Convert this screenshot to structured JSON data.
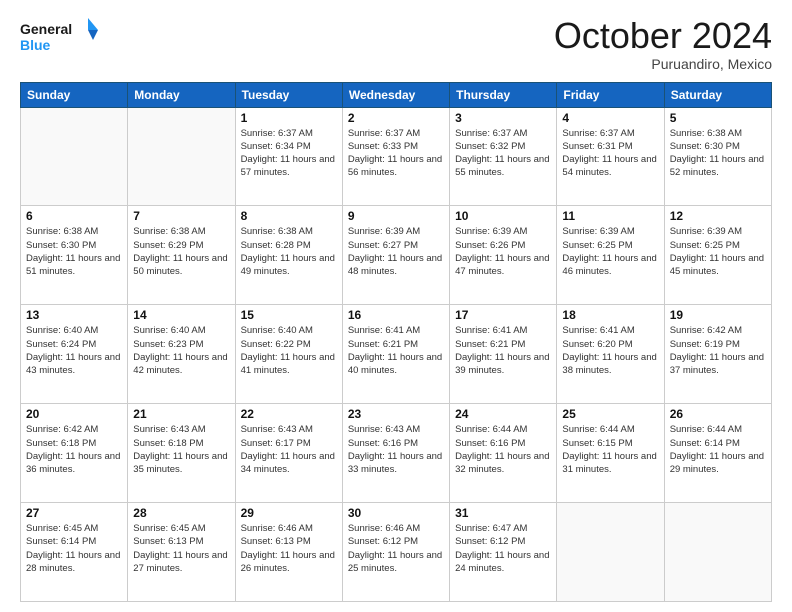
{
  "header": {
    "logo_line1": "General",
    "logo_line2": "Blue",
    "month_title": "October 2024",
    "subtitle": "Puruandiro, Mexico"
  },
  "weekdays": [
    "Sunday",
    "Monday",
    "Tuesday",
    "Wednesday",
    "Thursday",
    "Friday",
    "Saturday"
  ],
  "weeks": [
    [
      {
        "day": "",
        "info": ""
      },
      {
        "day": "",
        "info": ""
      },
      {
        "day": "1",
        "info": "Sunrise: 6:37 AM\nSunset: 6:34 PM\nDaylight: 11 hours and 57 minutes."
      },
      {
        "day": "2",
        "info": "Sunrise: 6:37 AM\nSunset: 6:33 PM\nDaylight: 11 hours and 56 minutes."
      },
      {
        "day": "3",
        "info": "Sunrise: 6:37 AM\nSunset: 6:32 PM\nDaylight: 11 hours and 55 minutes."
      },
      {
        "day": "4",
        "info": "Sunrise: 6:37 AM\nSunset: 6:31 PM\nDaylight: 11 hours and 54 minutes."
      },
      {
        "day": "5",
        "info": "Sunrise: 6:38 AM\nSunset: 6:30 PM\nDaylight: 11 hours and 52 minutes."
      }
    ],
    [
      {
        "day": "6",
        "info": "Sunrise: 6:38 AM\nSunset: 6:30 PM\nDaylight: 11 hours and 51 minutes."
      },
      {
        "day": "7",
        "info": "Sunrise: 6:38 AM\nSunset: 6:29 PM\nDaylight: 11 hours and 50 minutes."
      },
      {
        "day": "8",
        "info": "Sunrise: 6:38 AM\nSunset: 6:28 PM\nDaylight: 11 hours and 49 minutes."
      },
      {
        "day": "9",
        "info": "Sunrise: 6:39 AM\nSunset: 6:27 PM\nDaylight: 11 hours and 48 minutes."
      },
      {
        "day": "10",
        "info": "Sunrise: 6:39 AM\nSunset: 6:26 PM\nDaylight: 11 hours and 47 minutes."
      },
      {
        "day": "11",
        "info": "Sunrise: 6:39 AM\nSunset: 6:25 PM\nDaylight: 11 hours and 46 minutes."
      },
      {
        "day": "12",
        "info": "Sunrise: 6:39 AM\nSunset: 6:25 PM\nDaylight: 11 hours and 45 minutes."
      }
    ],
    [
      {
        "day": "13",
        "info": "Sunrise: 6:40 AM\nSunset: 6:24 PM\nDaylight: 11 hours and 43 minutes."
      },
      {
        "day": "14",
        "info": "Sunrise: 6:40 AM\nSunset: 6:23 PM\nDaylight: 11 hours and 42 minutes."
      },
      {
        "day": "15",
        "info": "Sunrise: 6:40 AM\nSunset: 6:22 PM\nDaylight: 11 hours and 41 minutes."
      },
      {
        "day": "16",
        "info": "Sunrise: 6:41 AM\nSunset: 6:21 PM\nDaylight: 11 hours and 40 minutes."
      },
      {
        "day": "17",
        "info": "Sunrise: 6:41 AM\nSunset: 6:21 PM\nDaylight: 11 hours and 39 minutes."
      },
      {
        "day": "18",
        "info": "Sunrise: 6:41 AM\nSunset: 6:20 PM\nDaylight: 11 hours and 38 minutes."
      },
      {
        "day": "19",
        "info": "Sunrise: 6:42 AM\nSunset: 6:19 PM\nDaylight: 11 hours and 37 minutes."
      }
    ],
    [
      {
        "day": "20",
        "info": "Sunrise: 6:42 AM\nSunset: 6:18 PM\nDaylight: 11 hours and 36 minutes."
      },
      {
        "day": "21",
        "info": "Sunrise: 6:43 AM\nSunset: 6:18 PM\nDaylight: 11 hours and 35 minutes."
      },
      {
        "day": "22",
        "info": "Sunrise: 6:43 AM\nSunset: 6:17 PM\nDaylight: 11 hours and 34 minutes."
      },
      {
        "day": "23",
        "info": "Sunrise: 6:43 AM\nSunset: 6:16 PM\nDaylight: 11 hours and 33 minutes."
      },
      {
        "day": "24",
        "info": "Sunrise: 6:44 AM\nSunset: 6:16 PM\nDaylight: 11 hours and 32 minutes."
      },
      {
        "day": "25",
        "info": "Sunrise: 6:44 AM\nSunset: 6:15 PM\nDaylight: 11 hours and 31 minutes."
      },
      {
        "day": "26",
        "info": "Sunrise: 6:44 AM\nSunset: 6:14 PM\nDaylight: 11 hours and 29 minutes."
      }
    ],
    [
      {
        "day": "27",
        "info": "Sunrise: 6:45 AM\nSunset: 6:14 PM\nDaylight: 11 hours and 28 minutes."
      },
      {
        "day": "28",
        "info": "Sunrise: 6:45 AM\nSunset: 6:13 PM\nDaylight: 11 hours and 27 minutes."
      },
      {
        "day": "29",
        "info": "Sunrise: 6:46 AM\nSunset: 6:13 PM\nDaylight: 11 hours and 26 minutes."
      },
      {
        "day": "30",
        "info": "Sunrise: 6:46 AM\nSunset: 6:12 PM\nDaylight: 11 hours and 25 minutes."
      },
      {
        "day": "31",
        "info": "Sunrise: 6:47 AM\nSunset: 6:12 PM\nDaylight: 11 hours and 24 minutes."
      },
      {
        "day": "",
        "info": ""
      },
      {
        "day": "",
        "info": ""
      }
    ]
  ]
}
